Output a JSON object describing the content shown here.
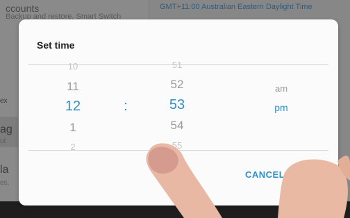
{
  "background": {
    "accounts_title": "ccounts",
    "accounts_subtitle": "Backup and restore, Smart Switch",
    "timezone": "GMT+11:00 Australian Eastern Daylight Time",
    "frag_ex": "ex",
    "frag_ag": "ag",
    "frag_ut": "ut",
    "frag_la": "la",
    "frag_es": "es,"
  },
  "dialog": {
    "title": "Set time",
    "hours": [
      "10",
      "11",
      "12",
      "1",
      "2"
    ],
    "separator": ":",
    "minutes": [
      "51",
      "52",
      "53",
      "54",
      "55"
    ],
    "am": "am",
    "pm": "pm",
    "selected_hour": "12",
    "selected_minute": "53",
    "selected_period": "pm",
    "cancel_label": "CANCEL"
  },
  "colors": {
    "accent": "#2e8fc4"
  }
}
